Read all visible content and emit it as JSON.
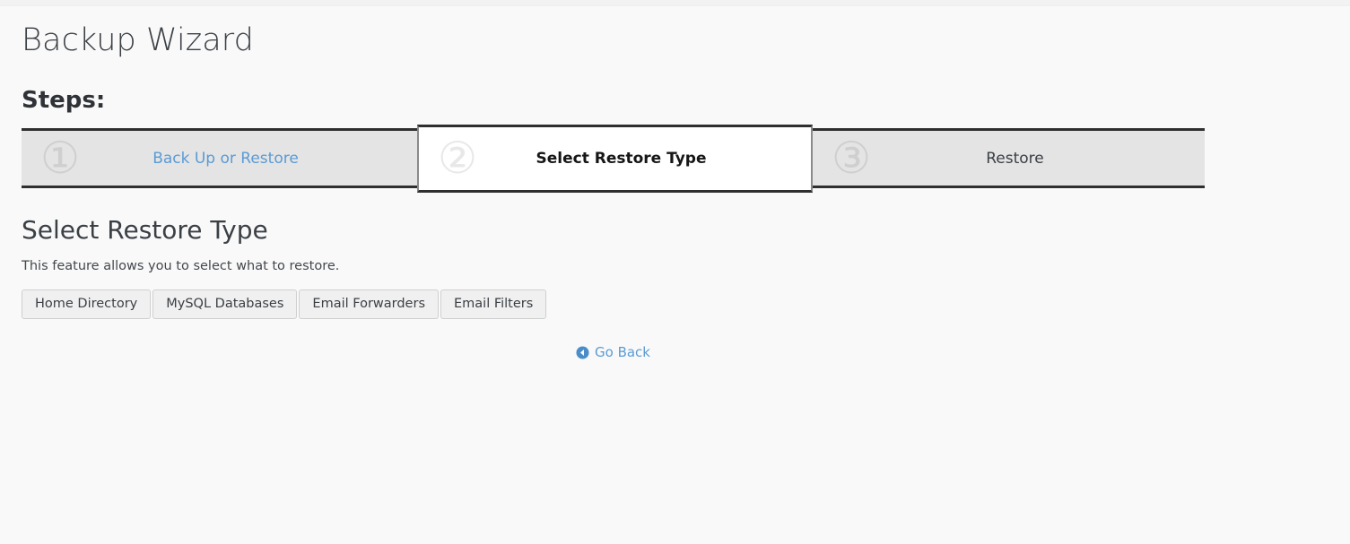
{
  "page": {
    "title": "Backup Wizard",
    "steps_label": "Steps:"
  },
  "steps": [
    {
      "number": "①",
      "label": "Back Up or Restore",
      "state": "completed"
    },
    {
      "number": "②",
      "label": "Select Restore Type",
      "state": "active"
    },
    {
      "number": "③",
      "label": "Restore",
      "state": "pending"
    }
  ],
  "main": {
    "heading": "Select Restore Type",
    "description": "This feature allows you to select what to restore.",
    "restore_type_buttons": [
      "Home Directory",
      "MySQL Databases",
      "Email Forwarders",
      "Email Filters"
    ],
    "go_back": {
      "label": "Go Back",
      "icon": "arrow-circle-left-icon"
    }
  },
  "colors": {
    "link": "#5b9bd5",
    "page_background": "#f9f9f9",
    "step_inactive_background": "#e4e4e4",
    "step_active_background": "#ffffff",
    "step_border": "#2f2f2f",
    "text": "#3b4045"
  }
}
